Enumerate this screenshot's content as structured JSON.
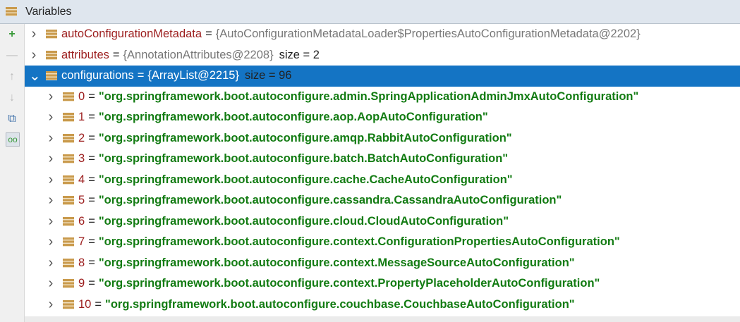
{
  "panel": {
    "title": "Variables"
  },
  "gutter": [
    "add-watch-icon",
    "remove-icon",
    "up-arrow-icon",
    "down-arrow-icon",
    "copy-icon",
    "watch-glasses-icon"
  ],
  "variables": [
    {
      "name": "autoConfigurationMetadata",
      "value": "{AutoConfigurationMetadataLoader$PropertiesAutoConfigurationMetadata@2202}",
      "size": ""
    },
    {
      "name": "attributes",
      "value": "{AnnotationAttributes@2208}",
      "size": "size = 2"
    },
    {
      "name": "configurations",
      "value": "{ArrayList@2215}",
      "size": "size = 96",
      "expanded": true,
      "selected": true
    }
  ],
  "items": [
    {
      "index": "0",
      "value": "\"org.springframework.boot.autoconfigure.admin.SpringApplicationAdminJmxAutoConfiguration\""
    },
    {
      "index": "1",
      "value": "\"org.springframework.boot.autoconfigure.aop.AopAutoConfiguration\""
    },
    {
      "index": "2",
      "value": "\"org.springframework.boot.autoconfigure.amqp.RabbitAutoConfiguration\""
    },
    {
      "index": "3",
      "value": "\"org.springframework.boot.autoconfigure.batch.BatchAutoConfiguration\""
    },
    {
      "index": "4",
      "value": "\"org.springframework.boot.autoconfigure.cache.CacheAutoConfiguration\""
    },
    {
      "index": "5",
      "value": "\"org.springframework.boot.autoconfigure.cassandra.CassandraAutoConfiguration\""
    },
    {
      "index": "6",
      "value": "\"org.springframework.boot.autoconfigure.cloud.CloudAutoConfiguration\""
    },
    {
      "index": "7",
      "value": "\"org.springframework.boot.autoconfigure.context.ConfigurationPropertiesAutoConfiguration\""
    },
    {
      "index": "8",
      "value": "\"org.springframework.boot.autoconfigure.context.MessageSourceAutoConfiguration\""
    },
    {
      "index": "9",
      "value": "\"org.springframework.boot.autoconfigure.context.PropertyPlaceholderAutoConfiguration\""
    },
    {
      "index": "10",
      "value": "\"org.springframework.boot.autoconfigure.couchbase.CouchbaseAutoConfiguration\""
    }
  ]
}
